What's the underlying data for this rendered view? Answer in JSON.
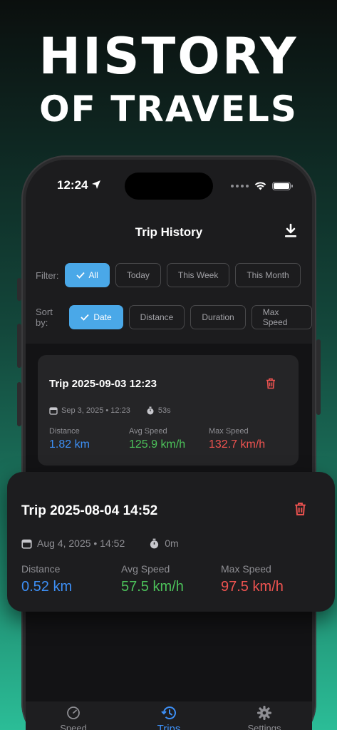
{
  "headline": {
    "line1": "HISTORY",
    "line2": "OF TRAVELS"
  },
  "status_bar": {
    "time": "12:24"
  },
  "nav": {
    "title": "Trip History"
  },
  "filter": {
    "label": "Filter:",
    "options": [
      "All",
      "Today",
      "This Week",
      "This Month"
    ],
    "selected": "All"
  },
  "sort": {
    "label": "Sort by:",
    "options": [
      "Date",
      "Distance",
      "Duration",
      "Max Speed"
    ],
    "selected": "Date"
  },
  "trips": [
    {
      "title": "Trip 2025-09-03 12:23",
      "date": "Sep 3, 2025 • 12:23",
      "duration": "53s",
      "distance_label": "Distance",
      "distance": "1.82 km",
      "avg_label": "Avg Speed",
      "avg_speed": "125.9 km/h",
      "max_label": "Max Speed",
      "max_speed": "132.7 km/h"
    },
    {
      "title": "Trip 2025-08-04 14:52",
      "date": "Aug 4, 2025 • 14:52",
      "duration": "0m",
      "distance_label": "Distance",
      "distance": "0.52 km",
      "avg_label": "Avg Speed",
      "avg_speed": "57.5 km/h",
      "max_label": "Max Speed",
      "max_speed": "97.5 km/h"
    }
  ],
  "tabs": [
    {
      "label": "Speed",
      "icon": "speedometer-icon",
      "active": false
    },
    {
      "label": "Trips",
      "icon": "history-icon",
      "active": true
    },
    {
      "label": "Settings",
      "icon": "gear-icon",
      "active": false
    }
  ],
  "colors": {
    "accent": "#4aa8e8",
    "distance": "#3d8ff5",
    "avg_speed": "#4cc25a",
    "max_speed": "#ef5350",
    "delete": "#ef5350"
  }
}
